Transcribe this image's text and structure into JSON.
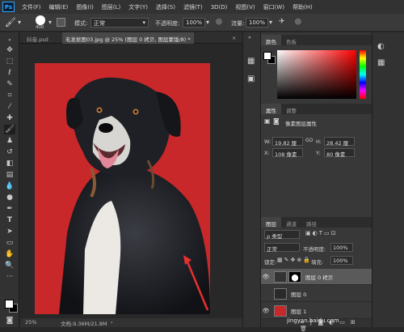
{
  "app": {
    "logo": "Ps"
  },
  "menu": [
    "文件(F)",
    "编辑(E)",
    "图像(I)",
    "图层(L)",
    "文字(Y)",
    "选择(S)",
    "滤镜(T)",
    "3D(D)",
    "视图(V)",
    "窗口(W)",
    "帮助(H)"
  ],
  "options": {
    "brush_size": "400",
    "mode_label": "模式:",
    "mode_value": "正常",
    "opacity_label": "不透明度:",
    "opacity_value": "100%",
    "flow_label": "流量:",
    "flow_value": "100%"
  },
  "tabs": [
    {
      "label": "抖音.psd",
      "active": false
    },
    {
      "label": "毛发抠图03.jpg @ 25% (图层 0 拷贝, 图层蒙版/8) *",
      "active": true
    },
    {
      "label": "×",
      "active": false
    }
  ],
  "status": {
    "zoom": "25%",
    "doc": "文档:9.36M/21.8M"
  },
  "color_panel": {
    "tabs": [
      "颜色",
      "色板"
    ],
    "foreground": "#ffffff",
    "background": "#000000",
    "hue_color": "#ff0000"
  },
  "properties_panel": {
    "tabs": [
      "属性",
      "调整"
    ],
    "title": "像素图层属性",
    "w_label": "W:",
    "w_value": "19.82 厘米",
    "h_label": "H:",
    "h_value": "28.42 厘米",
    "x_label": "X:",
    "x_value": "108 像素",
    "y_label": "Y:",
    "y_value": "80 像素",
    "link": "GO"
  },
  "layers_panel": {
    "tabs": [
      "图层",
      "通道",
      "路径"
    ],
    "filter": "ρ 类型",
    "blend_mode": "正常",
    "opacity_label": "不透明度:",
    "opacity_value": "100%",
    "lock_label": "锁定:",
    "fill_label": "填充:",
    "fill_value": "100%",
    "layers": [
      {
        "name": "图层 0 拷贝",
        "visible": true,
        "selected": true
      },
      {
        "name": "图层 0",
        "visible": false,
        "selected": false
      },
      {
        "name": "图层 1",
        "visible": true,
        "selected": false
      }
    ],
    "bottom_icons": [
      "link-icon",
      "fx-icon",
      "mask-icon",
      "adjust-icon",
      "folder-icon",
      "new-layer-icon",
      "trash-icon"
    ]
  },
  "watermark": "jingyan.baidu.com"
}
